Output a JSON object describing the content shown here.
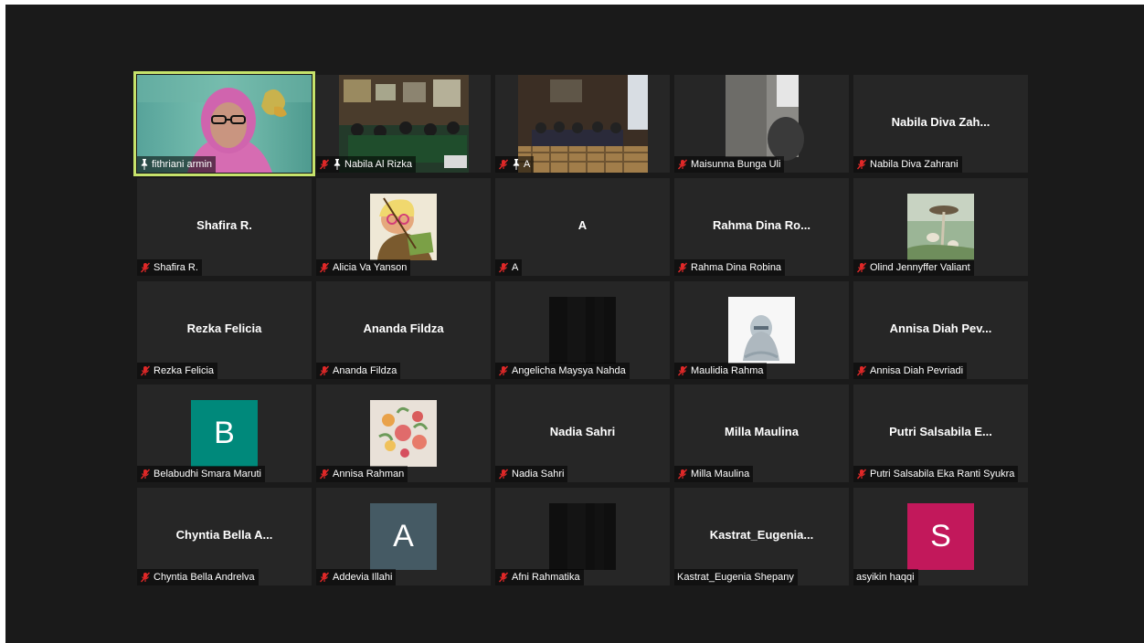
{
  "participants": [
    {
      "label": "fithriani armin",
      "pinned": true,
      "muted": false,
      "kind": "video",
      "video": "v1",
      "active": true
    },
    {
      "label": "Nabila Al Rizka",
      "pinned": true,
      "muted": true,
      "kind": "video",
      "video": "v2"
    },
    {
      "label": "A",
      "pinned": true,
      "muted": true,
      "kind": "video",
      "video": "v3"
    },
    {
      "label": "Maisunna Bunga Uli",
      "muted": true,
      "kind": "video",
      "video": "v4"
    },
    {
      "label": "Nabila Diva Zahrani",
      "muted": true,
      "kind": "name",
      "display": "Nabila Diva Zah..."
    },
    {
      "label": "Shafira R.",
      "muted": true,
      "kind": "name",
      "display": "Shafira R."
    },
    {
      "label": "Alicia Va Yanson",
      "muted": true,
      "kind": "image",
      "image": "img-cartoon"
    },
    {
      "label": "A",
      "muted": true,
      "kind": "name",
      "display": "A"
    },
    {
      "label": "Rahma Dina Robina",
      "muted": true,
      "kind": "name",
      "display": "Rahma Dina Ro..."
    },
    {
      "label": "Olind Jennyffer Valiant",
      "muted": true,
      "kind": "image",
      "image": "img-mushroom"
    },
    {
      "label": "Rezka Felicia",
      "muted": true,
      "kind": "name",
      "display": "Rezka Felicia"
    },
    {
      "label": "Ananda Fildza",
      "muted": true,
      "kind": "name",
      "display": "Ananda Fildza"
    },
    {
      "label": "Angelicha Maysya Nahda",
      "muted": true,
      "kind": "image",
      "image": "img-dark"
    },
    {
      "label": "Maulidia Rahma",
      "muted": true,
      "kind": "image",
      "image": "img-hijab"
    },
    {
      "label": "Annisa Diah Pevriadi",
      "muted": true,
      "kind": "name",
      "display": "Annisa Diah Pev..."
    },
    {
      "label": "Belabudhi Smara Maruti",
      "muted": true,
      "kind": "avatar",
      "letter": "B",
      "color": "#00897b"
    },
    {
      "label": "Annisa Rahman",
      "muted": true,
      "kind": "image",
      "image": "img-flowers"
    },
    {
      "label": "Nadia Sahri",
      "muted": true,
      "kind": "name",
      "display": "Nadia Sahri"
    },
    {
      "label": "Milla Maulina",
      "muted": true,
      "kind": "name",
      "display": "Milla Maulina"
    },
    {
      "label": "Putri Salsabila Eka Ranti Syukra",
      "muted": true,
      "kind": "name",
      "display": "Putri Salsabila E..."
    },
    {
      "label": "Chyntia Bella Andrelva",
      "muted": true,
      "kind": "name",
      "display": "Chyntia Bella A..."
    },
    {
      "label": "Addevia Illahi",
      "muted": true,
      "kind": "avatar",
      "letter": "A",
      "color": "#455a64"
    },
    {
      "label": "Afni Rahmatika",
      "muted": true,
      "kind": "image",
      "image": "img-dark"
    },
    {
      "label": "Kastrat_Eugenia Shepany",
      "muted": false,
      "kind": "name",
      "display": "Kastrat_Eugenia..."
    },
    {
      "label": "asyikin haqqi",
      "muted": false,
      "kind": "avatar",
      "letter": "S",
      "color": "#c2185b"
    }
  ],
  "colors": {
    "background": "#1a1a1a",
    "tile": "#262626",
    "active_border": "#c6e36b",
    "mic_off": "#e02828"
  }
}
